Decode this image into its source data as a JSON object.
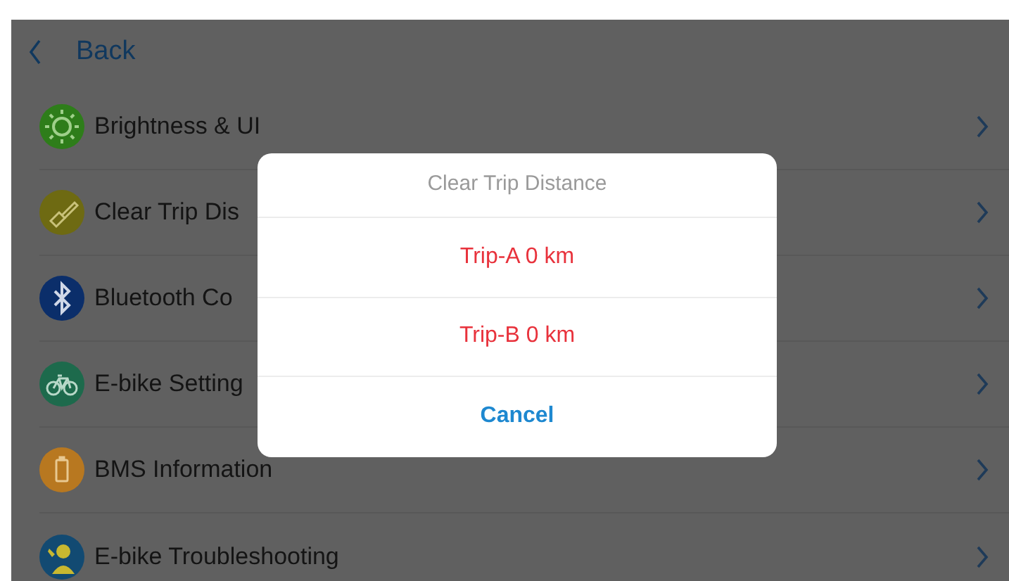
{
  "header": {
    "back_label": "Back"
  },
  "menu_items": [
    {
      "kind": "sun",
      "label": "Brightness & UI",
      "color": "#2e7d1a"
    },
    {
      "kind": "brush",
      "label": "Clear Trip Dis",
      "color": "#6e6a12"
    },
    {
      "kind": "bluetooth",
      "label": "Bluetooth Co",
      "color": "#0b2e6a"
    },
    {
      "kind": "bike",
      "label": "E-bike Setting",
      "color": "#1d6a4c"
    },
    {
      "kind": "battery",
      "label": "BMS Information",
      "color": "#b87820"
    },
    {
      "kind": "mechanic",
      "label": "E-bike Troubleshooting",
      "color": "#124a72"
    }
  ],
  "dialog": {
    "title": "Clear Trip Distance",
    "actions": [
      {
        "kind": "destructive",
        "label": "Trip-A 0 km"
      },
      {
        "kind": "destructive",
        "label": "Trip-B 0 km"
      },
      {
        "kind": "cancel",
        "label": "Cancel"
      }
    ]
  }
}
